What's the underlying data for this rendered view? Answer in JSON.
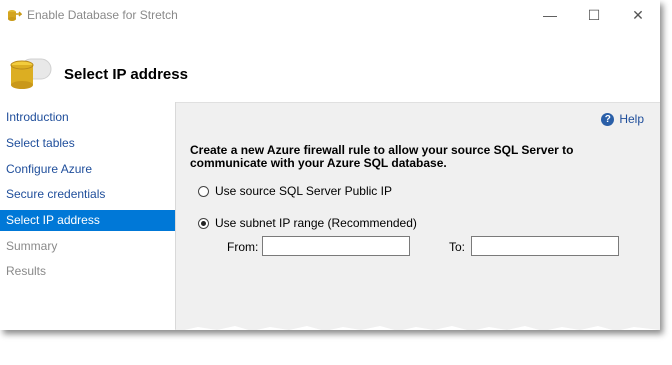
{
  "window": {
    "title": "Enable Database for Stretch",
    "controls": {
      "minimize": "—",
      "maximize": "☐",
      "close": "✕"
    }
  },
  "header": {
    "title": "Select IP address",
    "icon": "database-stretch-icon"
  },
  "sidebar": {
    "items": [
      {
        "label": "Introduction",
        "state": "link"
      },
      {
        "label": "Select tables",
        "state": "link"
      },
      {
        "label": "Configure Azure",
        "state": "link"
      },
      {
        "label": "Secure credentials",
        "state": "link"
      },
      {
        "label": "Select IP address",
        "state": "selected"
      },
      {
        "label": "Summary",
        "state": "disabled"
      },
      {
        "label": "Results",
        "state": "disabled"
      }
    ]
  },
  "content": {
    "help_label": "Help",
    "help_icon": "?",
    "description": "Create a new Azure firewall rule to allow your source SQL Server to communicate with your Azure SQL database.",
    "options": [
      {
        "label": "Use source SQL Server Public IP",
        "checked": false
      },
      {
        "label": "Use subnet IP range (Recommended)",
        "checked": true
      }
    ],
    "from_label": "From:",
    "from_value": "",
    "to_label": "To:",
    "to_value": ""
  },
  "colors": {
    "accent": "#0078d7",
    "link": "#1f4e9b",
    "panel_bg": "#f0f0f0"
  }
}
